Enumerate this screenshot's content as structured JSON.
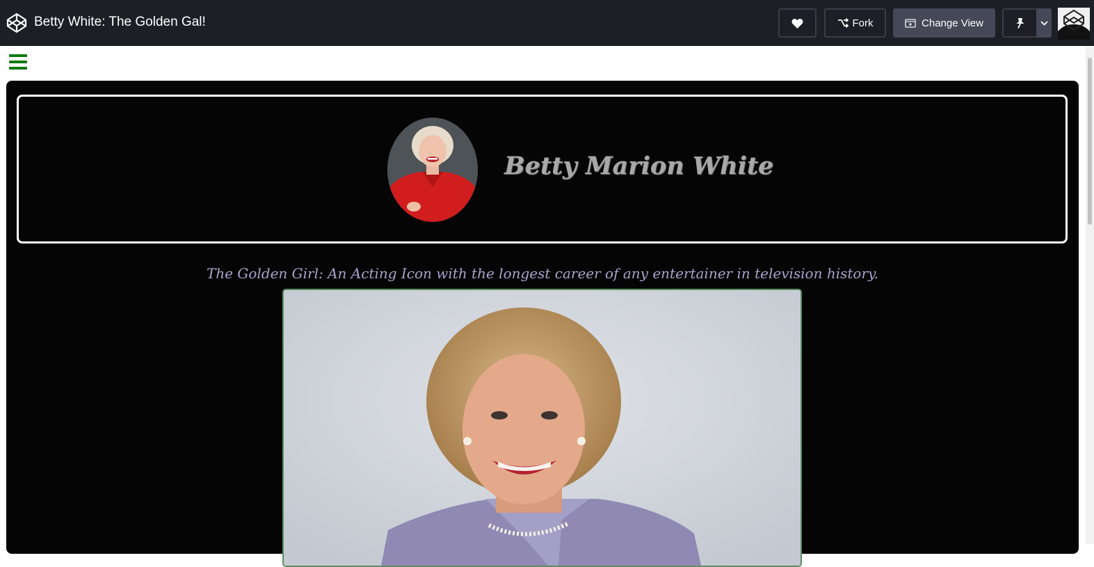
{
  "topbar": {
    "title": "Betty White: The Golden Gal!",
    "fork_label": "Fork",
    "change_view_label": "Change View",
    "icons": {
      "logo": "codepen-logo-icon",
      "heart": "heart-icon",
      "fork": "fork-icon",
      "change_view": "change-view-icon",
      "pin": "pin-icon",
      "dropdown": "chevron-down-icon"
    }
  },
  "page": {
    "menu_icon": "hamburger-menu-icon",
    "header": {
      "name": "Betty Marion White"
    },
    "tagline": "The Golden Girl: An Acting Icon with the longest career of any entertainer in television history."
  },
  "colors": {
    "topbar_bg": "#1e1f26",
    "button_active_bg": "#444857",
    "menu_green": "#0f7a12",
    "main_bg": "#050505",
    "name_color": "#a8a8a8",
    "tagline_color": "#a9a3cf",
    "photo_border": "#5c8e62"
  }
}
